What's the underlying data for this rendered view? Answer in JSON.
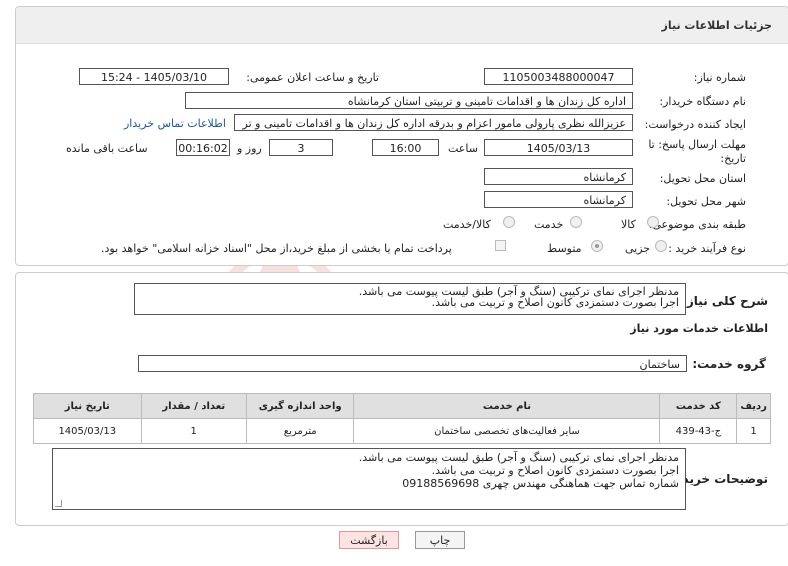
{
  "header": {
    "title": "جزئیات اطلاعات نیاز"
  },
  "fields": {
    "need_number_label": "شماره نیاز:",
    "need_number": "1105003488000047",
    "announce_label": "تاریخ و ساعت اعلان عمومی:",
    "announce_value": "1405/03/10 - 15:24",
    "buyer_org_label": "نام دستگاه خریدار:",
    "buyer_org": "اداره کل زندان ها و اقدامات تامینی و تربیتی استان کرمانشاه",
    "creator_label": "ایجاد کننده درخواست:",
    "creator": "عزیزالله نظری پارولی مامور اعزام و بدرقه اداره کل زندان ها و اقدامات تامینی و تر",
    "buyer_contact_link": "اطلاعات تماس خریدار",
    "deadline_label": "مهلت ارسال پاسخ: تا تاریخ:",
    "deadline_date": "1405/03/13",
    "time_label": "ساعت",
    "deadline_time": "16:00",
    "days_value": "3",
    "days_label": "روز و",
    "remaining_time": "00:16:02",
    "remaining_label": "ساعت باقی مانده",
    "province_label": "استان محل تحویل:",
    "province": "کرمانشاه",
    "city_label": "شهر محل تحویل:",
    "city": "کرمانشاه",
    "category_label": "طبقه بندی موضوعی:",
    "category_options": [
      "کالا",
      "خدمت",
      "کالا/خدمت"
    ],
    "category_selected": "خدمت",
    "process_label": "نوع فرآیند خرید :",
    "process_options": [
      "جزیی",
      "متوسط"
    ],
    "process_selected": "متوسط",
    "treasury_note": "پرداخت تمام یا بخشی از مبلغ خرید،از محل \"اسناد خزانه اسلامی\" خواهد بود."
  },
  "description": {
    "label": "شرح کلی نیاز:",
    "text": "مدنظر اجرای نمای ترکیبی (سنگ و آجر) طبق لیست پیوست می باشد.\nاجرا بصورت دستمزدی کانون اصلاح و تربیت می باشد."
  },
  "services": {
    "section_title": "اطلاعات خدمات مورد نیاز",
    "group_label": "گروه خدمت:",
    "group_value": "ساختمان",
    "columns": [
      "ردیف",
      "کد خدمت",
      "نام خدمت",
      "واحد اندازه گیری",
      "تعداد / مقدار",
      "تاریخ نیاز"
    ],
    "rows": [
      [
        "1",
        "ج-43-439",
        "سایر فعالیت‌های تخصصی ساختمان",
        "مترمربع",
        "1",
        "1405/03/13"
      ]
    ]
  },
  "buyer_notes": {
    "label": "توضیحات خریدار:",
    "text": "مدنظر اجرای نمای ترکیبی (سنگ و آجر) طبق لیست پیوست می باشد.\nاجرا بصورت دستمزدی کانون اصلاح و تربیت می باشد.\nشماره تماس جهت هماهنگی مهندس چهری 09188569698"
  },
  "buttons": {
    "print": "چاپ",
    "back": "بازگشت"
  },
  "watermark": "AriaTender.net",
  "colors": {
    "link": "#1a57a5",
    "back_button_bg": "#fde3e3",
    "header_bg": "#efefef",
    "table_header_bg": "#e0e0e0"
  }
}
